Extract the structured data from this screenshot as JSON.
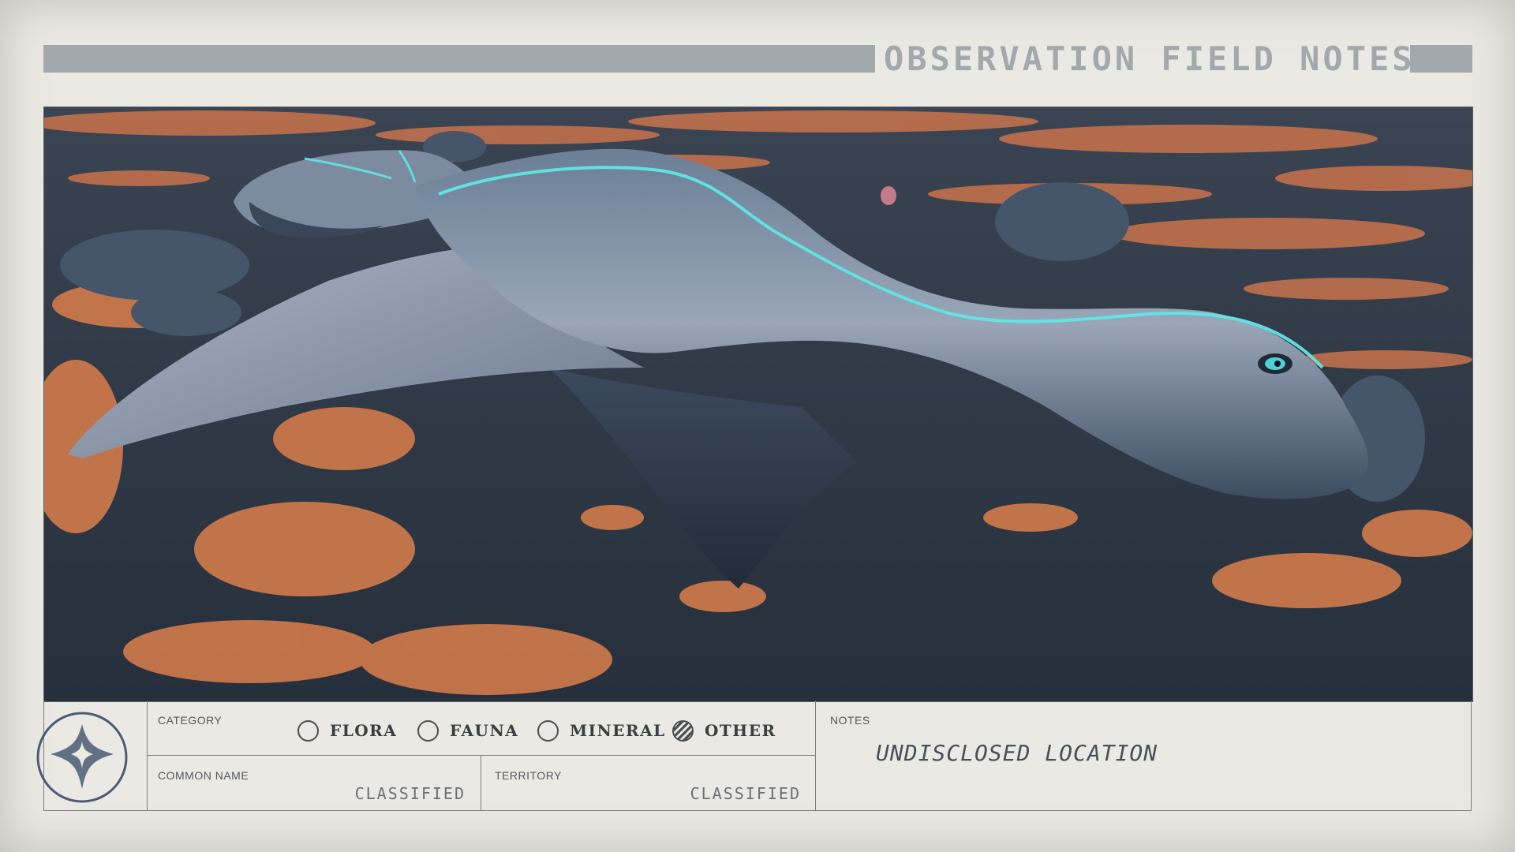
{
  "header": {
    "title": "OBSERVATION FIELD NOTES"
  },
  "form": {
    "category_label": "CATEGORY",
    "options": [
      {
        "label": "FLORA",
        "selected": false
      },
      {
        "label": "FAUNA",
        "selected": false
      },
      {
        "label": "MINERAL",
        "selected": false
      },
      {
        "label": "OTHER",
        "selected": true
      }
    ],
    "common_name_label": "COMMON NAME",
    "common_name_value": "CLASSIFIED",
    "territory_label": "TERRITORY",
    "territory_value": "CLASSIFIED",
    "notes_label": "NOTES",
    "notes_value": "UNDISCLOSED LOCATION"
  },
  "photo": {
    "subject": "creature-photo"
  },
  "colors": {
    "paper": "#eae9e3",
    "header_bar": "#a3a8ad",
    "ink": "#3a3e42",
    "glow": "#5fe6e6",
    "ground_orange": "#d9784a",
    "ground_dark": "#2b3542"
  },
  "icons": {
    "emblem": "compass-star-icon"
  }
}
